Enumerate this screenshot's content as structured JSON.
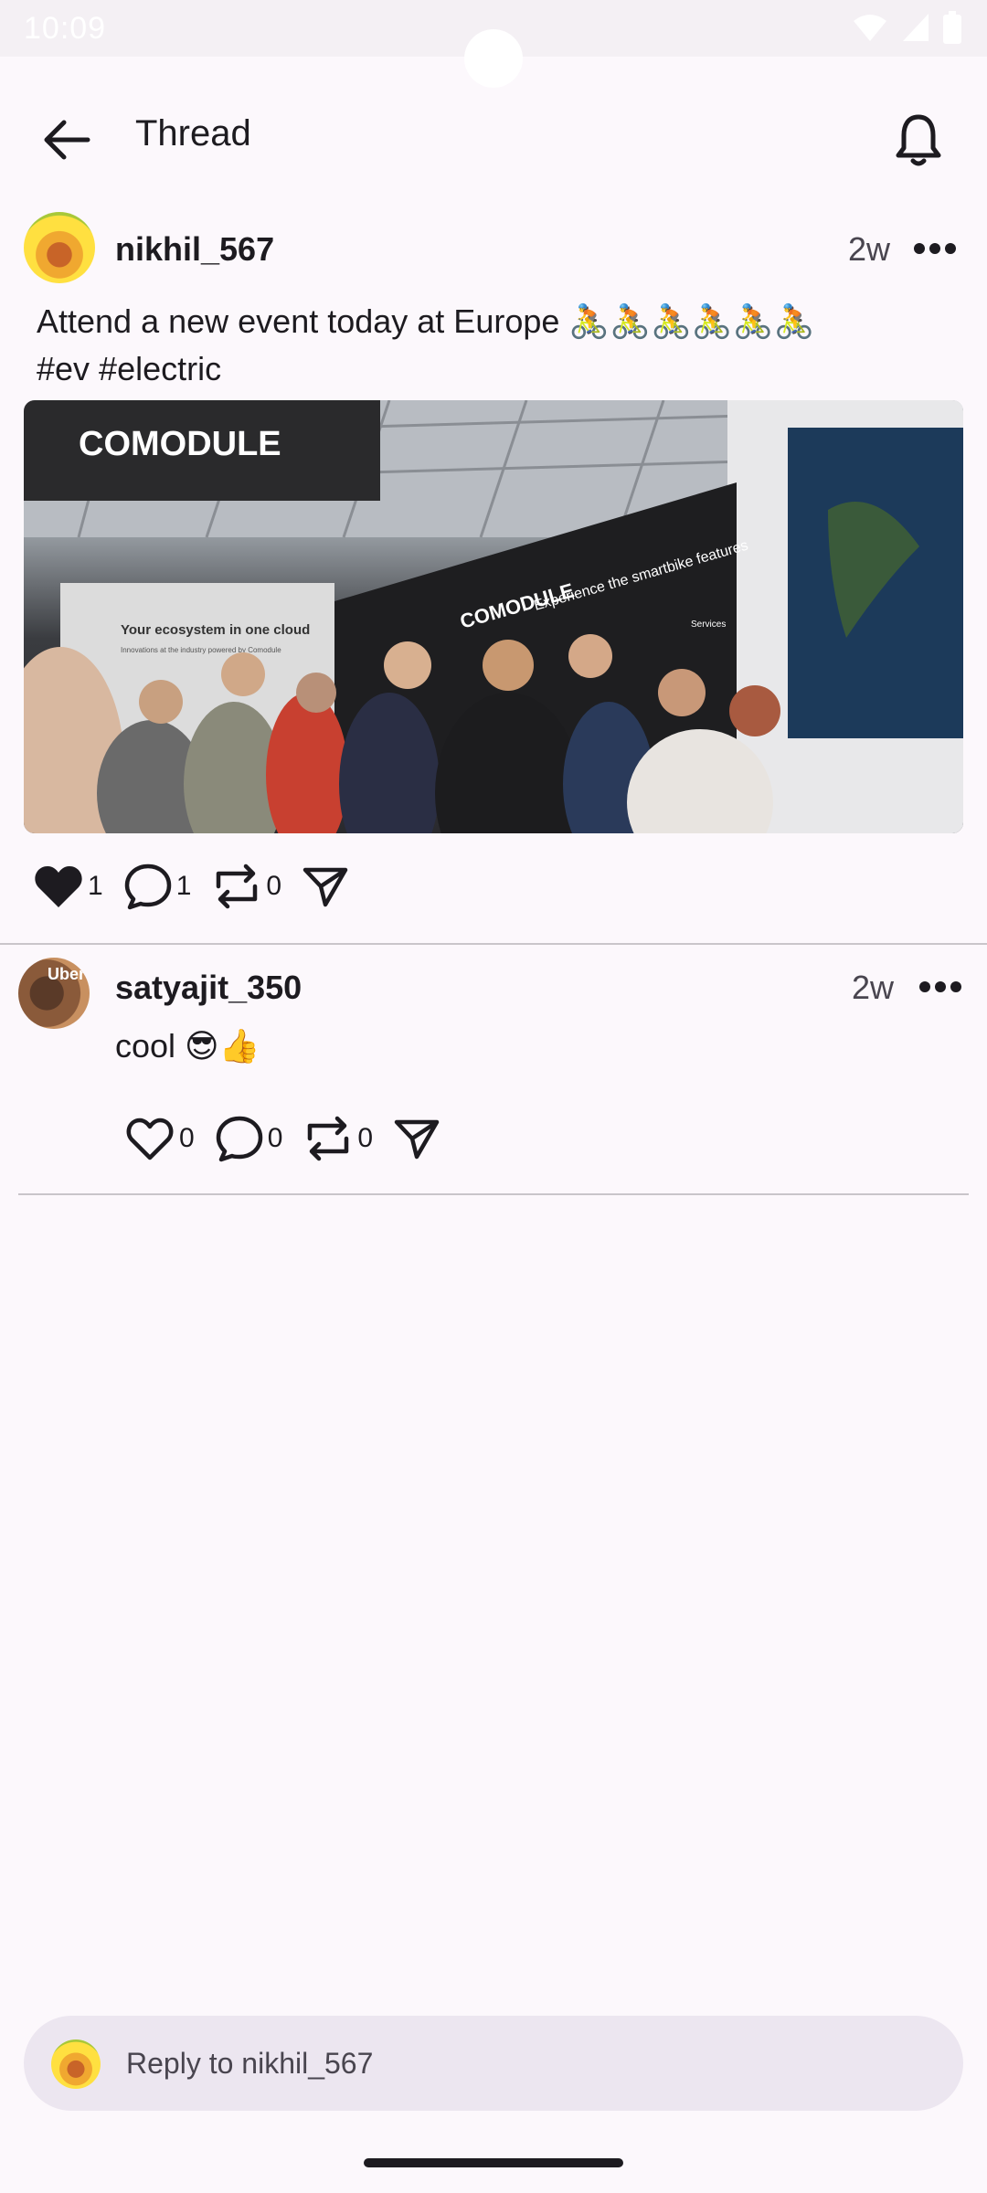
{
  "status_bar": {
    "time": "10:09"
  },
  "app_bar": {
    "title": "Thread"
  },
  "post": {
    "username": "nikhil_567",
    "time": "2w",
    "text_line1": "Attend a new event today at Europe 🚴🚴🚴🚴🚴🚴",
    "text_line2": "#ev #electric",
    "image": {
      "banner_text": "COMODULE",
      "wall_text": "Your ecosystem in one cloud",
      "wall_subtext": "Innovations at the industry powered by Comodule",
      "booth_text": "Experience the smartbike features",
      "booth_logo": "COMODULE",
      "services_label": "Services"
    },
    "likes": "1",
    "comments": "1",
    "reposts": "0"
  },
  "reply": {
    "username": "satyajit_350",
    "time": "2w",
    "text": "cool 😎👍",
    "avatar_text": "Uber",
    "likes": "0",
    "comments": "0",
    "reposts": "0"
  },
  "reply_bar": {
    "placeholder": "Reply to nikhil_567"
  },
  "colors": {
    "background": "#fcf8fc",
    "reply_bar": "#ece6f0",
    "divider": "#c9c5ca"
  }
}
